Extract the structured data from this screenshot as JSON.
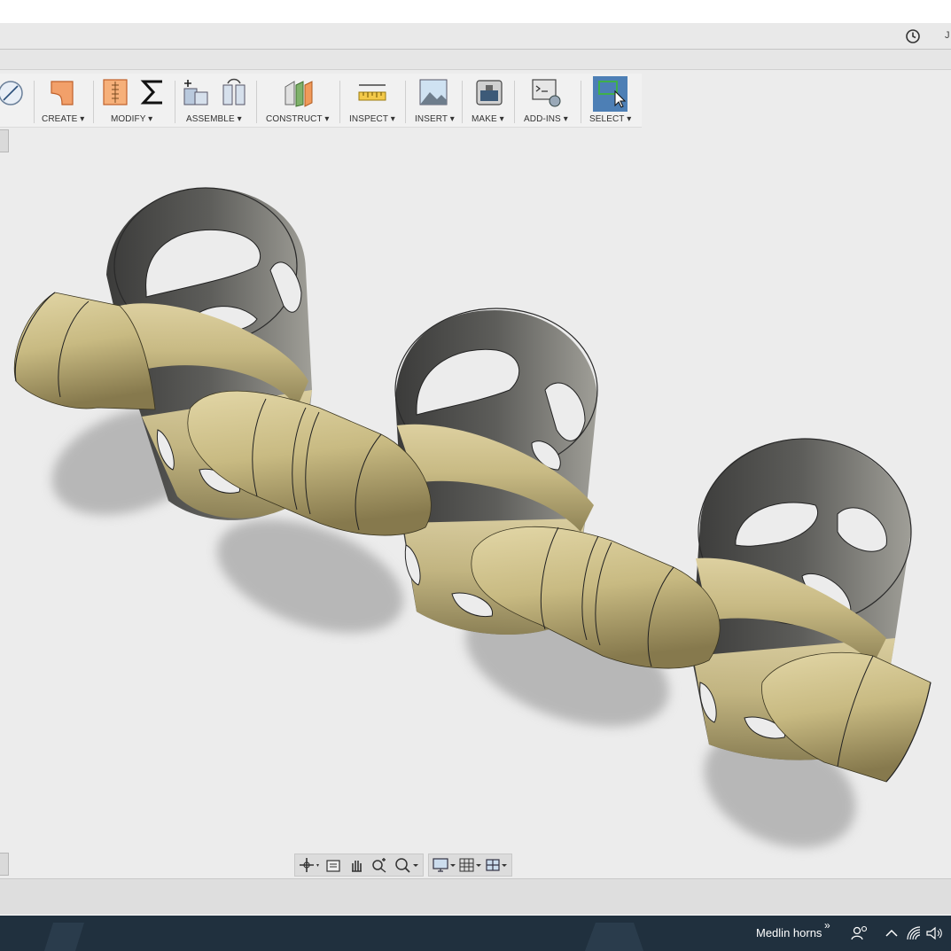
{
  "titlebar": {
    "user_initial": "J",
    "history_icon": "clock-icon"
  },
  "toolbar": {
    "groups": [
      {
        "label": "CREATE ▾",
        "icon": "create-shape-icon"
      },
      {
        "label": "MODIFY ▾",
        "icons": [
          "press-pull-icon",
          "sigma-icon"
        ]
      },
      {
        "label": "ASSEMBLE ▾",
        "icons": [
          "new-component-icon",
          "joint-icon"
        ]
      },
      {
        "label": "CONSTRUCT ▾",
        "icon": "plane-icon"
      },
      {
        "label": "INSPECT ▾",
        "icon": "measure-icon"
      },
      {
        "label": "INSERT ▾",
        "icon": "image-icon"
      },
      {
        "label": "MAKE ▾",
        "icon": "3d-print-icon"
      },
      {
        "label": "ADD-INS ▾",
        "icon": "scripts-icon"
      },
      {
        "label": "SELECT ▾",
        "icon": "select-window-icon",
        "active": true
      }
    ]
  },
  "navbar": {
    "tools": [
      "orbit-icon",
      "look-at-icon",
      "pan-icon",
      "zoom-icon",
      "fit-icon"
    ],
    "display": [
      "display-settings-icon",
      "grid-icon",
      "viewports-icon"
    ]
  },
  "taskbar": {
    "window_label": "Medlin horns",
    "overflow": "»"
  },
  "colors": {
    "model_gold": "#c9bb82",
    "model_interior": "#4a4a48",
    "viewport_bg": "#ececec",
    "taskbar_bg": "#20303e",
    "select_active": "#4d7fb5"
  }
}
